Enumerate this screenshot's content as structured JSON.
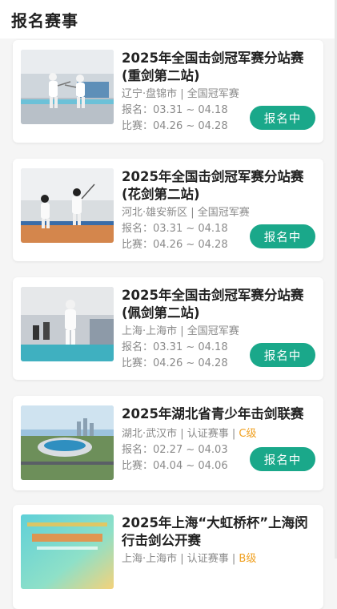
{
  "header": {
    "title": "报名赛事"
  },
  "events": [
    {
      "title": "2025年全国击剑冠军赛分站赛(重剑第二站)",
      "location": "辽宁·盘锦市 | 全国冠军赛",
      "level": "",
      "signup": "报名：03.31 ~ 04.18",
      "match": "比赛：04.26 ~ 04.28",
      "button": "报名中",
      "thumb": "fencing-hall-epee"
    },
    {
      "title": "2025年全国击剑冠军赛分站赛(花剑第二站)",
      "location": "河北·雄安新区 | 全国冠军赛",
      "level": "",
      "signup": "报名：03.31 ~ 04.18",
      "match": "比赛：04.26 ~ 04.28",
      "button": "报名中",
      "thumb": "fencing-hall-foil"
    },
    {
      "title": "2025年全国击剑冠军赛分站赛(佩剑第二站)",
      "location": "上海·上海市 | 全国冠军赛",
      "level": "",
      "signup": "报名：03.31 ~ 04.18",
      "match": "比赛：04.26 ~ 04.28",
      "button": "报名中",
      "thumb": "fencing-hall-sabre"
    },
    {
      "title": "2025年湖北省青少年击剑联赛",
      "location": "湖北·武汉市 | 认证赛事 | ",
      "level": "C级",
      "signup": "报名：02.27 ~ 04.03",
      "match": "比赛：04.04 ~ 04.06",
      "button": "报名中",
      "thumb": "stadium-aerial"
    },
    {
      "title": "2025年上海“大虹桥杯”上海闵行击剑公开赛",
      "location": "上海·上海市 | 认证赛事 | ",
      "level": "B级",
      "signup": "",
      "match": "",
      "button": "",
      "thumb": "event-poster"
    }
  ]
}
